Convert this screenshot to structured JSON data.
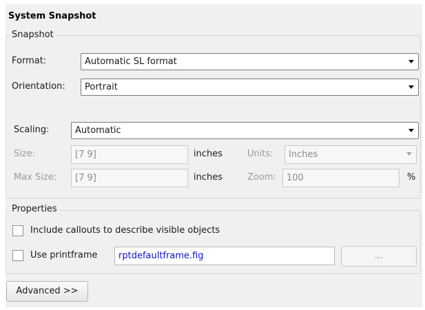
{
  "title": "System Snapshot",
  "snapshot_group": {
    "legend": "Snapshot",
    "format_label": "Format:",
    "format_value": "Automatic SL format",
    "orientation_label": "Orientation:",
    "orientation_value": "Portrait",
    "scaling_label": "Scaling:",
    "scaling_value": "Automatic",
    "size_label": "Size:",
    "size_value": "[7 9]",
    "size_unit": "inches",
    "units_label": "Units:",
    "units_value": "Inches",
    "max_size_label": "Max Size:",
    "max_size_value": "[7 9]",
    "max_size_unit": "inches",
    "zoom_label": "Zoom:",
    "zoom_value": "100",
    "zoom_unit": "%"
  },
  "properties_group": {
    "legend": "Properties",
    "include_callouts_label": "Include callouts to describe visible objects",
    "include_callouts_checked": false,
    "use_printframe_label": "Use printframe",
    "use_printframe_checked": false,
    "printframe_value": "rptdefaultframe.fig",
    "browse_label": "..."
  },
  "advanced_label": "Advanced >>",
  "colors": {
    "panel_background": "#f0f0f0",
    "printframe_text": "#1010c8",
    "disabled_text": "#9a9a9a"
  }
}
